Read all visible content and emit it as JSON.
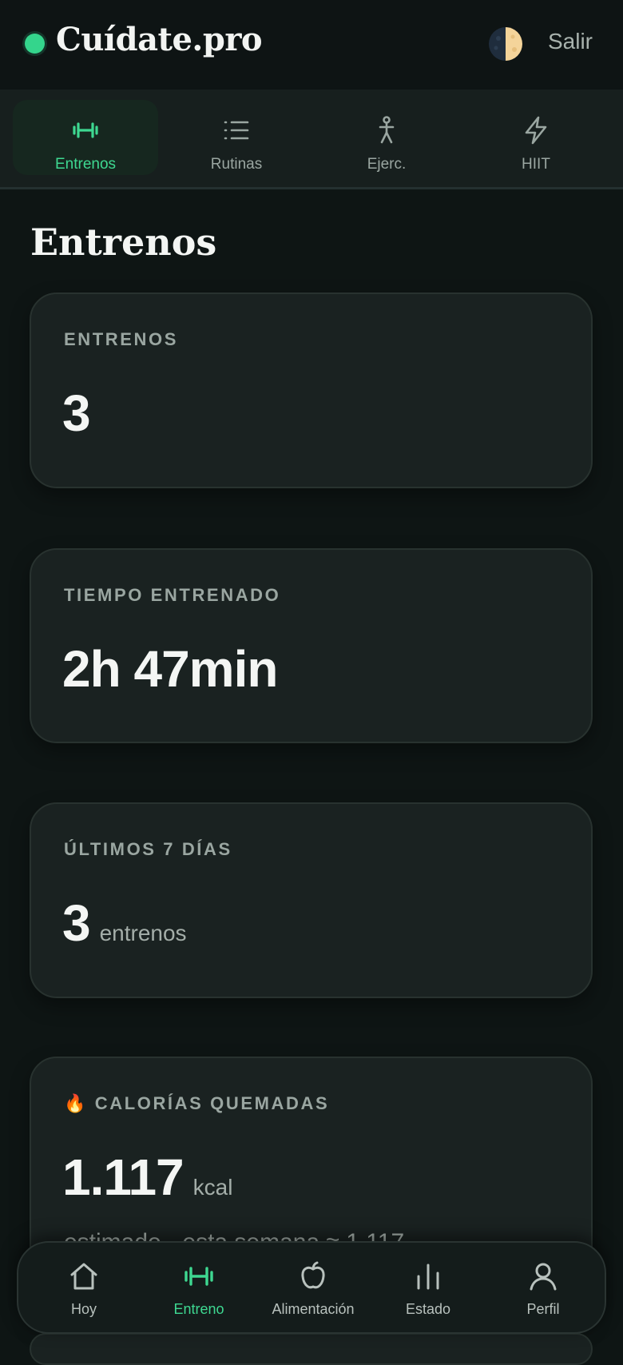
{
  "header": {
    "brand": "Cuídate.pro",
    "logout_label": "Salir",
    "theme_icon": "half-moon-icon"
  },
  "subnav": {
    "tabs": [
      {
        "label": "Entrenos",
        "icon": "dumbbell-icon",
        "active": true
      },
      {
        "label": "Rutinas",
        "icon": "list-icon",
        "active": false
      },
      {
        "label": "Ejerc.",
        "icon": "person-icon",
        "active": false
      },
      {
        "label": "HIIT",
        "icon": "lightning-icon",
        "active": false
      }
    ]
  },
  "page": {
    "title": "Entrenos"
  },
  "cards": [
    {
      "label": "ENTRENOS",
      "value": "3"
    },
    {
      "label": "TIEMPO ENTRENADO",
      "value": "2h 47min"
    },
    {
      "label": "ÚLTIMOS 7 DÍAS",
      "value": "3",
      "unit": "entrenos"
    },
    {
      "emoji": "🔥",
      "label": "CALORÍAS QUEMADAS",
      "value": "1.117",
      "unit": "kcal",
      "note": "estimado · esta semana ≈ 1.117"
    }
  ],
  "bottom_nav": {
    "items": [
      {
        "label": "Hoy",
        "icon": "home-icon",
        "active": false
      },
      {
        "label": "Entreno",
        "icon": "dumbbell-icon",
        "active": true
      },
      {
        "label": "Alimentación",
        "icon": "apple-icon",
        "active": false
      },
      {
        "label": "Estado",
        "icon": "bar-chart-icon",
        "active": false
      },
      {
        "label": "Perfil",
        "icon": "user-icon",
        "active": false
      }
    ]
  },
  "colors": {
    "accent": "#3ed891",
    "background": "#0e1514",
    "card": "#1a2221"
  }
}
